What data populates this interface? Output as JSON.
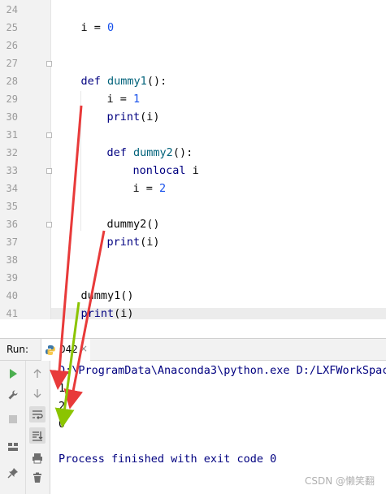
{
  "editor": {
    "line_numbers": [
      "24",
      "25",
      "26",
      "27",
      "28",
      "29",
      "30",
      "31",
      "32",
      "33",
      "34",
      "35",
      "36",
      "37",
      "38",
      "39",
      "40",
      "41"
    ],
    "code": {
      "l24": {
        "a": "i = ",
        "b": "0"
      },
      "l27": {
        "kw": "def ",
        "fn": "dummy1",
        "rest": "():"
      },
      "l28": {
        "a": "i = ",
        "b": "1"
      },
      "l29": {
        "a": "print",
        "b": "(i)"
      },
      "l31": {
        "kw": "def ",
        "fn": "dummy2",
        "rest": "():"
      },
      "l32": {
        "kw": "nonlocal ",
        "rest": "i"
      },
      "l33": {
        "a": "i = ",
        "b": "2"
      },
      "l35": {
        "a": "dummy2()"
      },
      "l36": {
        "a": "print",
        "b": "(i)"
      },
      "l39": {
        "a": "dummy1()"
      },
      "l40": {
        "a": "print",
        "b": "(i)"
      }
    }
  },
  "run_panel": {
    "label": "Run:",
    "tab_label": "042",
    "tab_close": "×",
    "console": {
      "command": "D:\\ProgramData\\Anaconda3\\python.exe D:/LXFWorkSpace",
      "outputs": [
        "1",
        "2",
        "0"
      ],
      "process_message": "Process finished with exit code 0"
    }
  },
  "watermark": "CSDN @懒笑翻",
  "icons": {
    "run": "play-icon",
    "up": "arrow-up-icon",
    "down": "arrow-down-icon",
    "wrench": "wrench-icon",
    "stop": "stop-icon",
    "wrap": "soft-wrap-icon",
    "scroll": "scroll-to-end-icon",
    "layout": "layout-icon",
    "print": "print-icon",
    "pin": "pin-icon",
    "trash": "trash-icon",
    "python": "python-icon"
  },
  "colors": {
    "red_arrow": "#e83a3a",
    "green_arrow": "#8bc400",
    "run_green": "#4caf50"
  }
}
